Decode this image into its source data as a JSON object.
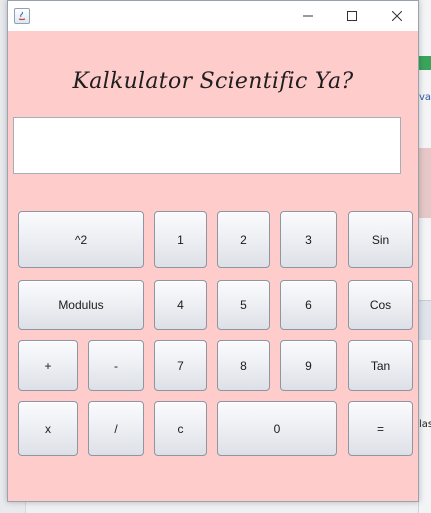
{
  "window": {
    "title": "",
    "controls": {
      "minimize": "minimize-icon",
      "maximize": "maximize-icon",
      "close": "close-icon"
    }
  },
  "app": {
    "heading": "Kalkulator Scientific Ya?",
    "display_value": ""
  },
  "keys": {
    "square": "^2",
    "one": "1",
    "two": "2",
    "three": "3",
    "sin": "Sin",
    "modulus": "Modulus",
    "four": "4",
    "five": "5",
    "six": "6",
    "cos": "Cos",
    "plus": "+",
    "minus": "-",
    "seven": "7",
    "eight": "8",
    "nine": "9",
    "tan": "Tan",
    "multiply": "x",
    "divide": "/",
    "clear": "c",
    "zero": "0",
    "equals": "="
  },
  "background_fragments": {
    "frag_a": "va",
    "frag_b": "las"
  },
  "colors": {
    "client_background": "#ffcccc",
    "button_face": "#eef0f4",
    "display_background": "#ffffff"
  }
}
